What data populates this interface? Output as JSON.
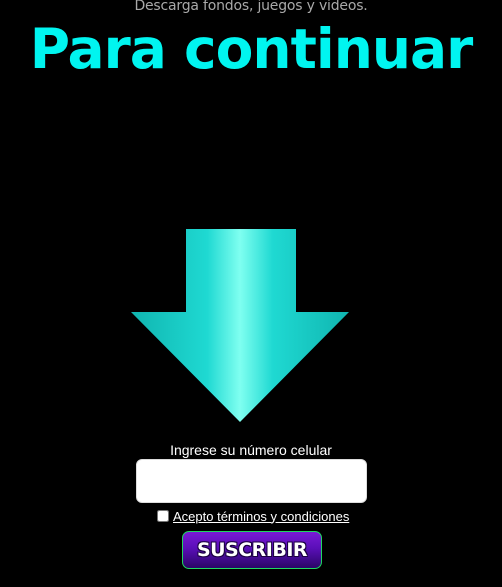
{
  "header": {
    "subtitle": "Descarga fondos, juegos y videos.",
    "headline": "Para continuar"
  },
  "arrow": {
    "icon": "down-arrow-icon",
    "colors": {
      "edge": "#10b5b0",
      "mid": "#1fd9d2",
      "highlight": "#7ffff0"
    }
  },
  "form": {
    "phone_label": "Ingrese su número celular",
    "phone_value": "",
    "phone_placeholder": "",
    "terms_label": "Acepto términos y condiciones",
    "terms_checked": false,
    "subscribe_label": "SUSCRIBIR"
  },
  "colors": {
    "background": "#000000",
    "headline": "#00f5f0",
    "button_top": "#7a1ad6",
    "button_bottom": "#2a0566",
    "button_border": "#1ed760"
  }
}
